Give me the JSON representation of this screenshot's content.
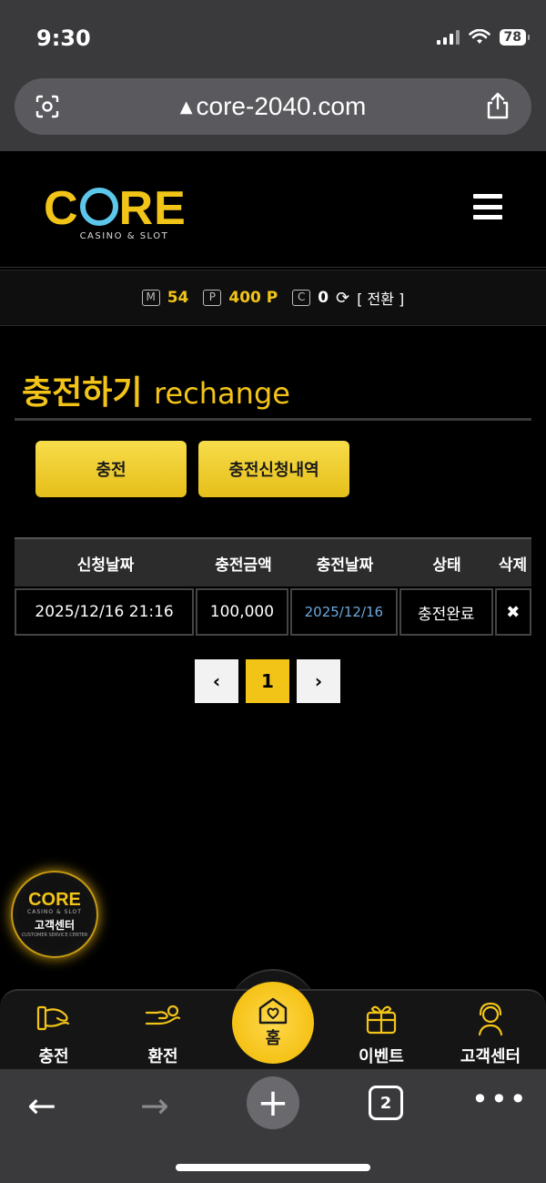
{
  "status": {
    "time": "9:30",
    "battery": "78"
  },
  "browser": {
    "url": "core-2040.com",
    "tab_count": "2"
  },
  "brand": {
    "logo_text_before": "C",
    "logo_text_after": "RE",
    "logo_sub": "CASINO & SLOT",
    "accent": "#f2c418"
  },
  "wallet": {
    "m_badge": "M",
    "m_value": "54",
    "p_badge": "P",
    "p_value": "400 P",
    "c_badge": "C",
    "c_value": "0",
    "convert_label": "[ 전환 ]"
  },
  "page": {
    "title_ko": "충전하기",
    "title_en": "rechange"
  },
  "actions": {
    "charge_label": "충전",
    "history_label": "충전신청내역"
  },
  "table": {
    "headers": [
      "신청날짜",
      "충전금액",
      "충전날짜",
      "상태",
      "삭제"
    ],
    "rows": [
      {
        "request_date": "2025/12/16 21:16",
        "amount": "100,000",
        "charge_date": "2025/12/16",
        "status": "충전완료",
        "delete": "✖"
      }
    ]
  },
  "pager": {
    "prev": "‹",
    "current": "1",
    "next": "›"
  },
  "support_badge": {
    "logo": "CORE",
    "sub": "CASINO & SLOT",
    "label": "고객센터",
    "foot": "CUSTOMER SERVICE CENTER"
  },
  "bottom_nav": {
    "charge": "충전",
    "exchange": "환전",
    "home": "홈",
    "event": "이벤트",
    "support": "고객센터"
  }
}
